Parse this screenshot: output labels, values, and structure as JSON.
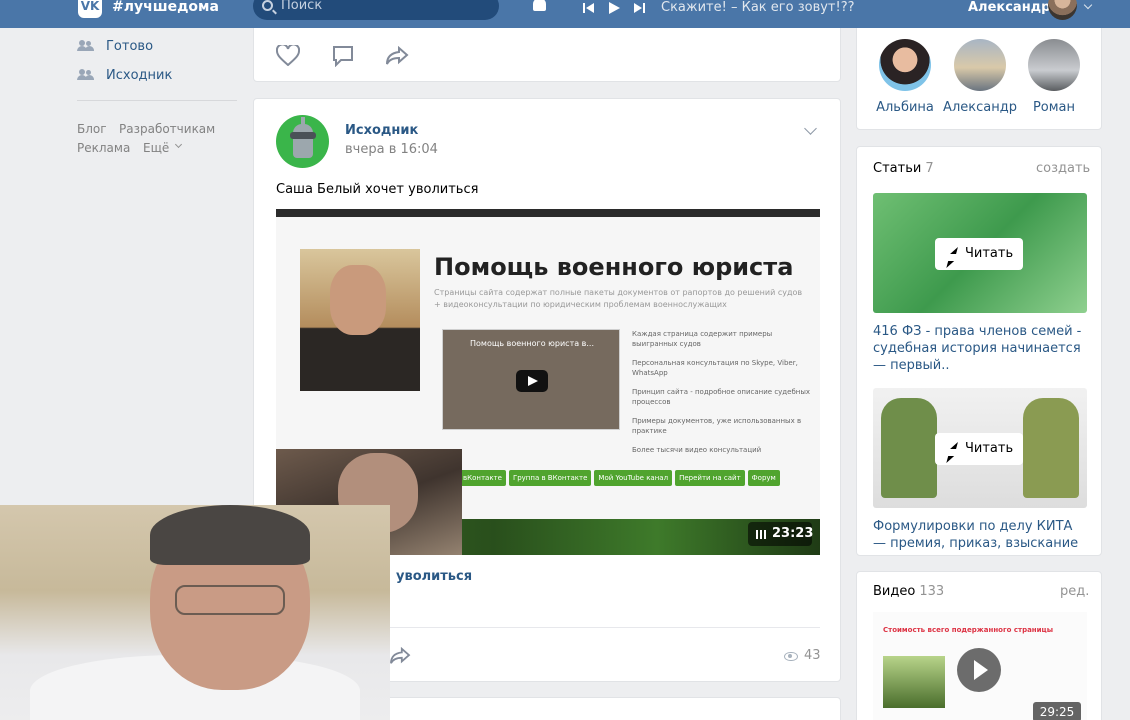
{
  "header": {
    "logo": "VK",
    "site_name": "#лучшедома",
    "search_placeholder": "Поиск",
    "track": "Скажите! – Как его зовут!??",
    "user_name": "Александр"
  },
  "left_nav": {
    "items": [
      {
        "label": "Готово",
        "icon": "group-icon"
      },
      {
        "label": "Исходник",
        "icon": "group-icon"
      }
    ],
    "footer": [
      "Блог",
      "Разработчикам",
      "Реклама",
      "Ещё"
    ]
  },
  "post": {
    "author": "Исходник",
    "time": "вчера в 16:04",
    "text": "Саша Белый хочет уволиться",
    "video": {
      "heading": "Помощь военного юриста",
      "subheading": "Страницы сайта содержат полные пакеты документов от рапортов до решений судов + видеоконсультации по юридическим проблемам военнослужащих",
      "embed_title": "Помощь военного юриста в...",
      "list": [
        "Каждая страница содержит примеры выигранных судов",
        "Персональная консультация по Skype, Viber, WhatsApp",
        "Принцип сайта - подробное описание судебных процессов",
        "Примеры документов, уже использованных в практике",
        "Более тысячи видео консультаций"
      ],
      "buttons": [
        "вКонтакте",
        "Группа в ВКонтакте",
        "Мой YouTube канал",
        "Перейти на сайт",
        "Форум"
      ],
      "duration": "23:23"
    },
    "link_title_visible": "уволиться",
    "views": "43"
  },
  "right": {
    "friends": [
      {
        "name": "Альбина"
      },
      {
        "name": "Александр"
      },
      {
        "name": "Роман"
      }
    ],
    "articles": {
      "label": "Статьи",
      "count": "7",
      "create": "создать",
      "read_label": "Читать",
      "items": [
        {
          "title": "416 ФЗ - права членов семей - судебная история начинается — первый.."
        },
        {
          "title": "Формулировки по делу КИТА — премия, приказ, взыскание"
        }
      ]
    },
    "videos": {
      "label": "Видео",
      "count": "133",
      "edit": "ред.",
      "duration": "29:25",
      "thumb_text": "Стоимость всего подержанного страницы"
    }
  }
}
